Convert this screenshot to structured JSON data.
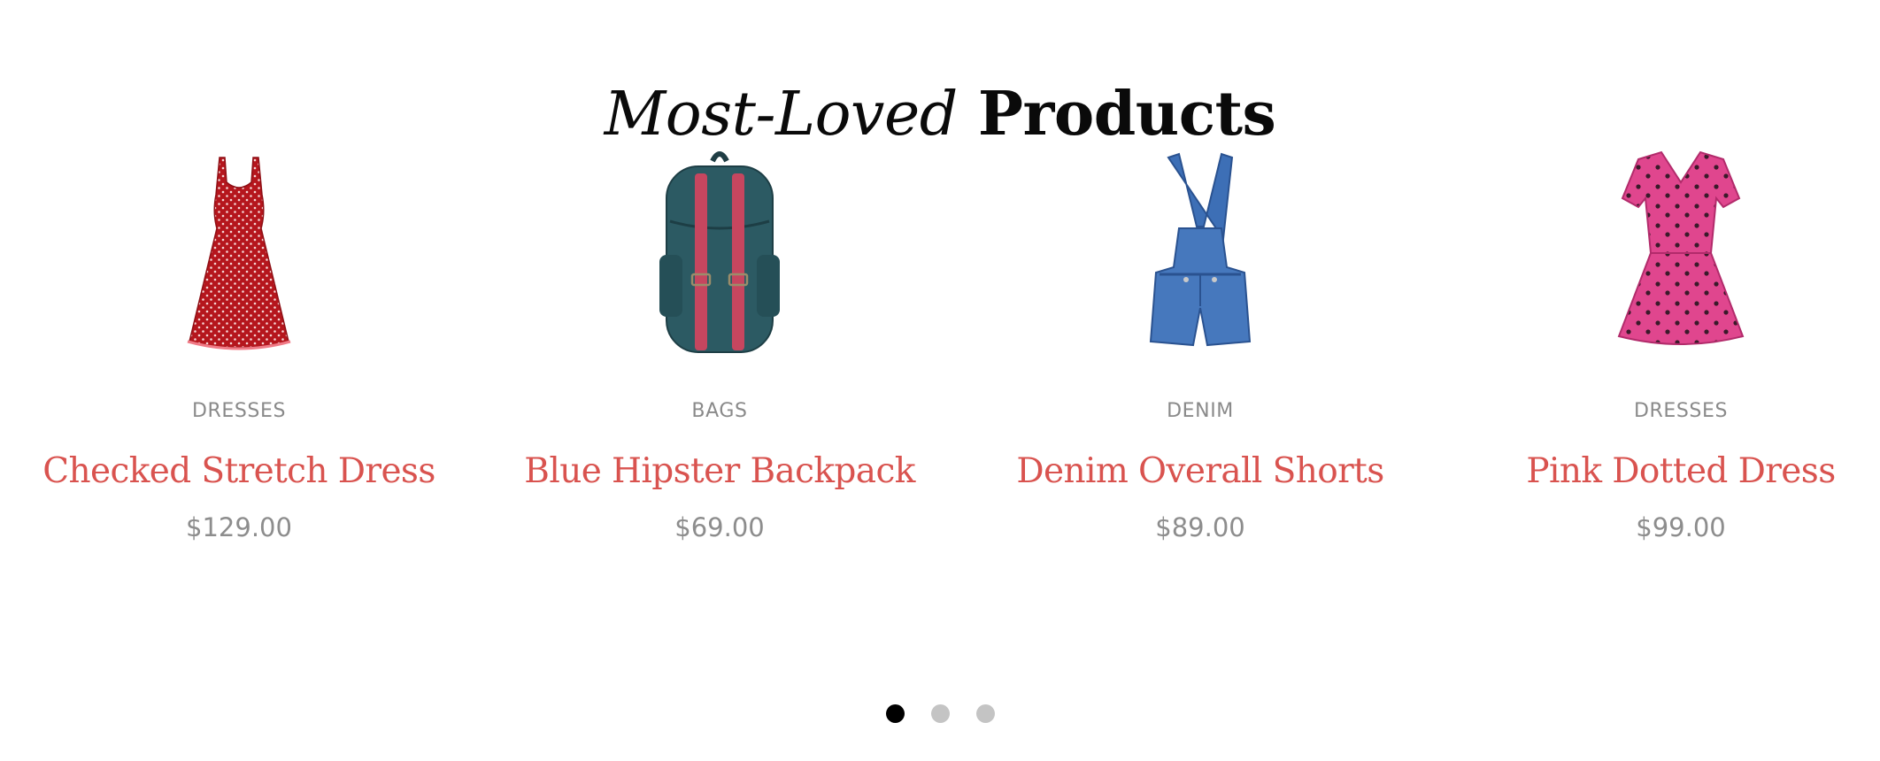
{
  "section": {
    "title_em": "Most-Loved",
    "title_strong": "Products"
  },
  "colors": {
    "name": "#d9534f",
    "muted": "#8a8a8a",
    "dot_active": "#000000",
    "dot_inactive": "#c4c4c4"
  },
  "products": [
    {
      "category": "DRESSES",
      "name": "Checked Stretch Dress",
      "price": "$129.00",
      "image": "red-polka-dot-dress-icon"
    },
    {
      "category": "BAGS",
      "name": "Blue Hipster Backpack",
      "price": "$69.00",
      "image": "teal-backpack-icon"
    },
    {
      "category": "DENIM",
      "name": "Denim Overall Shorts",
      "price": "$89.00",
      "image": "denim-overall-shorts-icon"
    },
    {
      "category": "DRESSES",
      "name": "Pink Dotted Dress",
      "price": "$99.00",
      "image": "pink-dotted-dress-icon"
    }
  ],
  "pagination": {
    "pages": 3,
    "active_index": 0
  }
}
